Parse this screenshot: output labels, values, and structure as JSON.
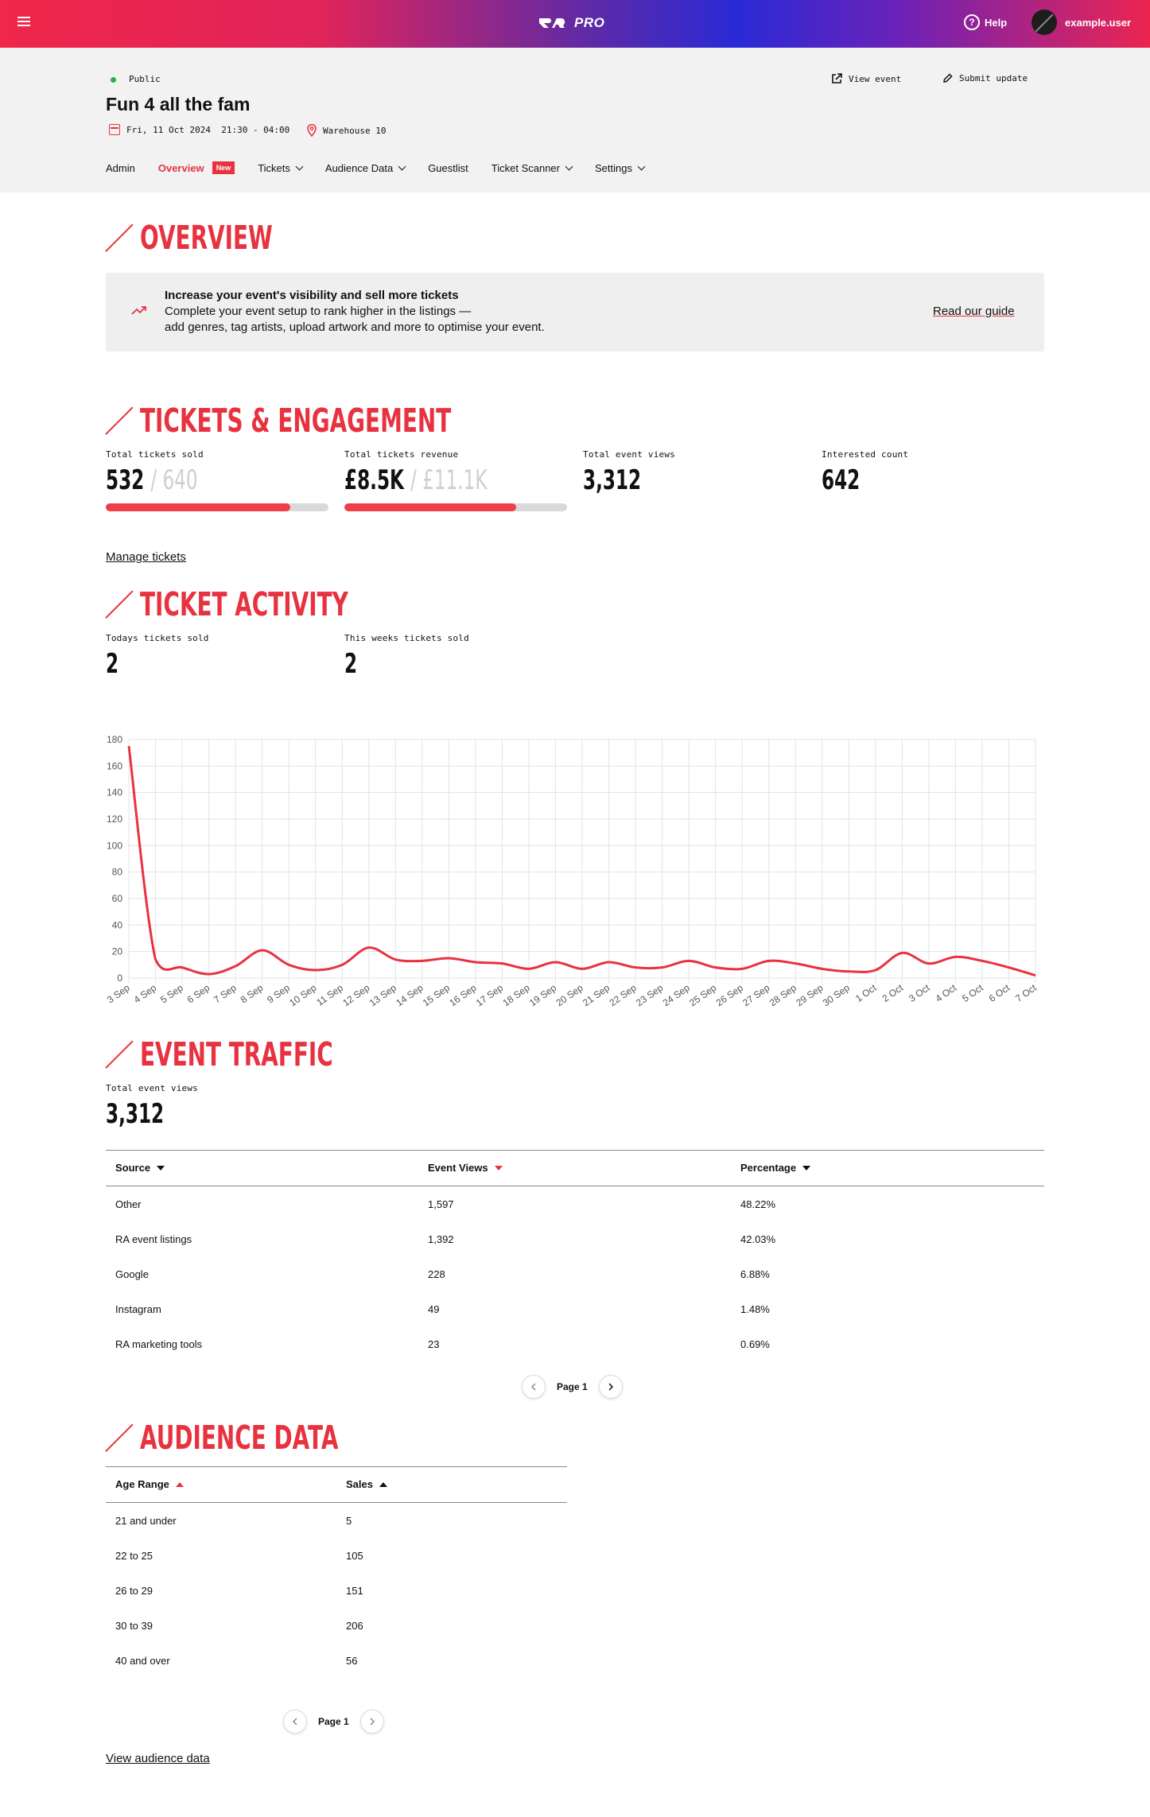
{
  "topbar": {
    "logo": "PRO",
    "help": "Help",
    "user": "example.user"
  },
  "header": {
    "status": "Public",
    "title": "Fun 4 all the fam",
    "date": "Fri, 11 Oct 2024  21:30 - 04:00",
    "venue": "Warehouse 10",
    "view_event": "View event",
    "submit_update": "Submit update",
    "tabs": [
      {
        "label": "Admin"
      },
      {
        "label": "Overview",
        "badge": "New"
      },
      {
        "label": "Tickets"
      },
      {
        "label": "Audience Data"
      },
      {
        "label": "Guestlist"
      },
      {
        "label": "Ticket Scanner"
      },
      {
        "label": "Settings"
      }
    ]
  },
  "overview": {
    "heading": "OVERVIEW",
    "banner": {
      "title": "Increase your event's visibility and sell more tickets",
      "line1": "Complete your event setup to rank higher in the listings —",
      "line2": "add genres, tag artists, upload artwork and more to optimise your event.",
      "link": "Read our guide"
    }
  },
  "engagement": {
    "heading": "TICKETS & ENGAGEMENT",
    "tickets_sold": {
      "label": "Total tickets sold",
      "value": "532",
      "total": "/ 640",
      "progress": 0.83
    },
    "revenue": {
      "label": "Total tickets revenue",
      "value": "£8.5K",
      "total": "/ £11.1K",
      "progress": 0.77
    },
    "views": {
      "label": "Total event views",
      "value": "3,312"
    },
    "interested": {
      "label": "Interested count",
      "value": "642"
    },
    "manage_link": "Manage tickets"
  },
  "activity": {
    "heading": "TICKET ACTIVITY",
    "today": {
      "label": "Todays tickets sold",
      "value": "2"
    },
    "week": {
      "label": "This weeks tickets sold",
      "value": "2"
    }
  },
  "chart_data": {
    "type": "line",
    "title": "",
    "xlabel": "",
    "ylabel": "",
    "ylim": [
      0,
      180
    ],
    "yticks": [
      0,
      20,
      40,
      60,
      80,
      100,
      120,
      140,
      160,
      180
    ],
    "grid": true,
    "color": "#e8323f",
    "x": [
      "3 Sep",
      "4 Sep",
      "5 Sep",
      "6 Sep",
      "7 Sep",
      "8 Sep",
      "9 Sep",
      "10 Sep",
      "11 Sep",
      "12 Sep",
      "13 Sep",
      "14 Sep",
      "15 Sep",
      "16 Sep",
      "17 Sep",
      "18 Sep",
      "19 Sep",
      "20 Sep",
      "21 Sep",
      "22 Sep",
      "23 Sep",
      "24 Sep",
      "25 Sep",
      "26 Sep",
      "27 Sep",
      "28 Sep",
      "29 Sep",
      "30 Sep",
      "1 Oct",
      "2 Oct",
      "3 Oct",
      "4 Oct",
      "5 Oct",
      "6 Oct",
      "7 Oct"
    ],
    "series": [
      {
        "values": [
          175,
          14,
          8,
          3,
          9,
          21,
          10,
          6,
          10,
          23,
          14,
          13,
          15,
          12,
          11,
          7,
          12,
          7,
          12,
          8,
          8,
          13,
          8,
          7,
          13,
          11,
          7,
          5,
          6,
          19,
          11,
          16,
          13,
          8,
          2
        ]
      }
    ]
  },
  "traffic": {
    "heading": "EVENT TRAFFIC",
    "views": {
      "label": "Total event views",
      "value": "3,312"
    },
    "columns": [
      "Source",
      "Event Views",
      "Percentage"
    ],
    "rows": [
      [
        "Other",
        "1,597",
        "48.22%"
      ],
      [
        "RA event listings",
        "1,392",
        "42.03%"
      ],
      [
        "Google",
        "228",
        "6.88%"
      ],
      [
        "Instagram",
        "49",
        "1.48%"
      ],
      [
        "RA marketing tools",
        "23",
        "0.69%"
      ]
    ],
    "page": "Page 1"
  },
  "audience": {
    "heading": "AUDIENCE DATA",
    "columns": [
      "Age Range",
      "Sales"
    ],
    "rows": [
      [
        "21 and under",
        "5"
      ],
      [
        "22 to 25",
        "105"
      ],
      [
        "26 to 29",
        "151"
      ],
      [
        "30 to 39",
        "206"
      ],
      [
        "40 and over",
        "56"
      ]
    ],
    "page": "Page 1",
    "link": "View audience data"
  }
}
